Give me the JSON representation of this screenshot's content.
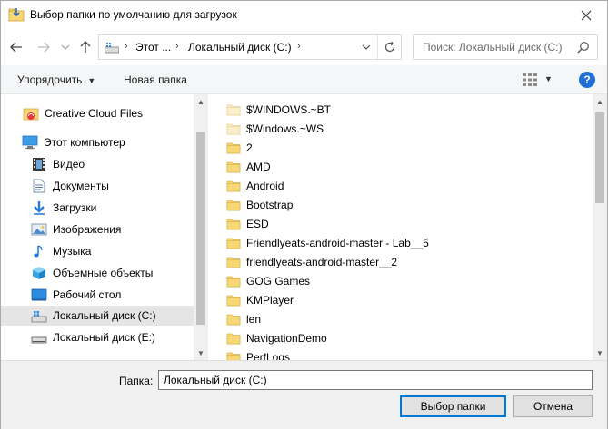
{
  "window": {
    "title": "Выбор папки по умолчанию для загрузок"
  },
  "address": {
    "part1": "Этот ...",
    "part2": "Локальный диск (C:)",
    "sep": "›"
  },
  "search": {
    "placeholder": "Поиск: Локальный диск (C:)"
  },
  "toolbar": {
    "organize": "Упорядочить",
    "new_folder": "Новая папка",
    "help": "?"
  },
  "nav": {
    "items": [
      {
        "label": "Creative Cloud Files",
        "icon": "creative-cloud-icon"
      },
      {
        "label": "Этот компьютер",
        "icon": "computer-icon"
      },
      {
        "label": "Видео",
        "icon": "video-icon"
      },
      {
        "label": "Документы",
        "icon": "documents-icon"
      },
      {
        "label": "Загрузки",
        "icon": "downloads-icon"
      },
      {
        "label": "Изображения",
        "icon": "pictures-icon"
      },
      {
        "label": "Музыка",
        "icon": "music-icon"
      },
      {
        "label": "Объемные объекты",
        "icon": "3d-objects-icon"
      },
      {
        "label": "Рабочий стол",
        "icon": "desktop-icon"
      },
      {
        "label": "Локальный диск (C:)",
        "icon": "drive-c-icon"
      },
      {
        "label": "Локальный диск (E:)",
        "icon": "drive-e-icon"
      }
    ],
    "selected_index": 9
  },
  "files": {
    "items": [
      {
        "label": "$WINDOWS.~BT",
        "hidden": true
      },
      {
        "label": "$Windows.~WS",
        "hidden": true
      },
      {
        "label": "2",
        "hidden": false
      },
      {
        "label": "AMD",
        "hidden": false
      },
      {
        "label": "Android",
        "hidden": false
      },
      {
        "label": "Bootstrap",
        "hidden": false
      },
      {
        "label": "ESD",
        "hidden": false
      },
      {
        "label": "Friendlyeats-android-master - Lab__5",
        "hidden": false
      },
      {
        "label": "friendlyeats-android-master__2",
        "hidden": false
      },
      {
        "label": "GOG Games",
        "hidden": false
      },
      {
        "label": "KMPlayer",
        "hidden": false
      },
      {
        "label": "len",
        "hidden": false
      },
      {
        "label": "NavigationDemo",
        "hidden": false
      },
      {
        "label": "PerfLogs",
        "hidden": false
      }
    ]
  },
  "bottom": {
    "folder_label": "Папка:",
    "folder_value": "Локальный диск (C:)",
    "select_button": "Выбор папки",
    "cancel_button": "Отмена"
  },
  "colors": {
    "selection": "#cce8ff",
    "folder_yellow": "#f8d775",
    "accent": "#0078d7"
  }
}
